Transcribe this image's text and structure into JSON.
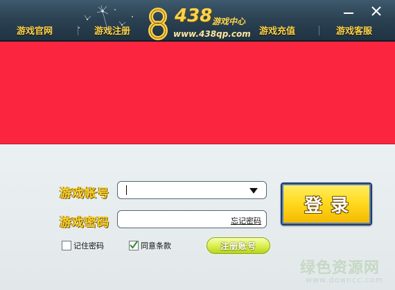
{
  "header": {
    "nav": [
      {
        "label": "游戏官网"
      },
      {
        "label": "游戏注册"
      },
      {
        "label": "游戏充值"
      },
      {
        "label": "游戏客服"
      }
    ],
    "logo": {
      "number": "438",
      "subtitle": "游戏中心",
      "url": "www.438qp.com"
    },
    "window_controls": {
      "minimize_icon": "minimize-icon",
      "close_icon": "close-icon"
    }
  },
  "banner": {
    "color": "#fc2540"
  },
  "login": {
    "account_label": "游戏帐号",
    "password_label": "游戏密码",
    "account_value": "",
    "forgot_password": "忘记密码",
    "login_button": "登录",
    "remember_password": "记住密码",
    "remember_checked": false,
    "agree_terms": "同意条款",
    "agree_checked": true,
    "register_button": "注册账号"
  },
  "watermark": {
    "name": "绿色资源网",
    "url": "www.downcc.com"
  },
  "colors": {
    "accent_gold": "#ffd22e",
    "header_bg": "#2b4253"
  }
}
